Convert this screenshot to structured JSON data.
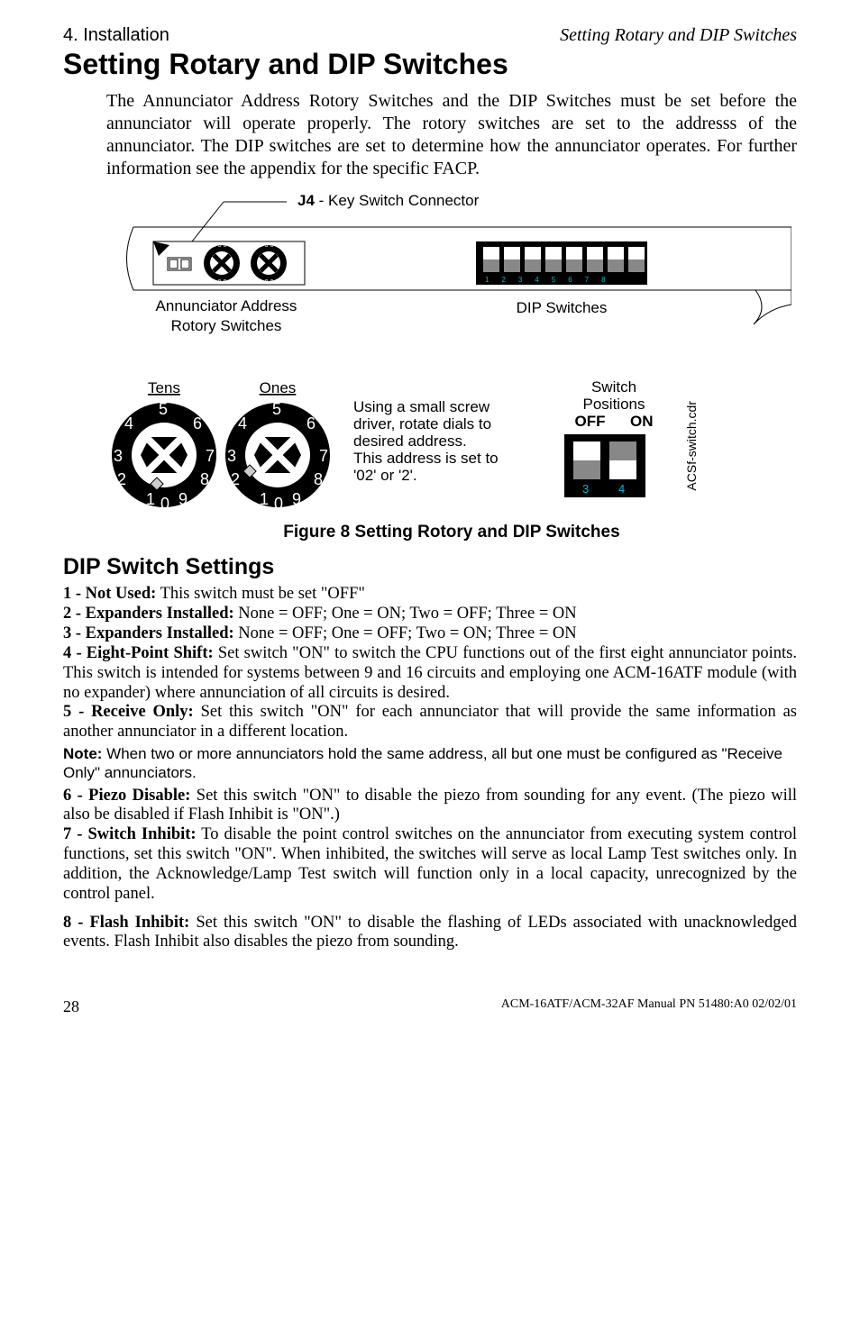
{
  "header": {
    "left": "4. Installation",
    "rightItalic": "Setting Rotary and DIP Switches"
  },
  "title": "Setting Rotary and DIP Switches",
  "intro": "The Annunciator Address Rotory Switches and the DIP Switches must be set before the annunciator will operate properly. The rotory switches are set to the addresss of the annunciator. The DIP switches are set to determine how the annunciator operates. For further information see the appendix for the specific FACP.",
  "figTop": {
    "j4Label": "J4",
    "j4Rest": " - Key Switch Connector",
    "annLine1": "Annunciator Address",
    "annLine2": "Rotory Switches",
    "dipLabel": "DIP Switches"
  },
  "figMid": {
    "tens": "Tens",
    "ones": "Ones",
    "instr1": "Using a small screw",
    "instr2": "driver, rotate dials to",
    "instr3": "desired address.",
    "instr4": "This address is set to",
    "instr5": "'02' or '2'.",
    "swLine1": "Switch",
    "swLine2": "Positions",
    "off": "OFF",
    "on": "ON",
    "cdr": "ACSf-switch.cdr"
  },
  "figCaption": "Figure 8  Setting Rotory and DIP Switches",
  "dipHeading": "DIP Switch Settings",
  "items": {
    "i1b": "1 - Not Used:",
    "i1": "  This switch must be set \"OFF\"",
    "i2b": "2 - Expanders Installed:",
    "i2": " None = OFF; One = ON; Two = OFF; Three = ON",
    "i3b": "3 - Expanders Installed:",
    "i3": " None = OFF; One = OFF; Two = ON; Three = ON",
    "i4b": "4 - Eight-Point Shift:",
    "i4": " Set switch \"ON\" to switch the CPU functions out of the first eight annunciator points. This switch is intended for systems between 9 and 16 circuits and employing one ACM-16ATF module (with no expander) where annunciation of all circuits is desired.",
    "i5b": "5 - Receive Only:",
    "i5": " Set this switch \"ON\" for each annunciator that will provide the same information as another annunciator in a different location.",
    "noteB": "Note:",
    "note": " When two or more annunciators hold the same address, all but one must be configured as \"Receive Only\" annunciators.",
    "i6b": "6 - Piezo Disable:",
    "i6": " Set this switch \"ON\" to disable the piezo from sounding for any event.  (The piezo will also be disabled if Flash Inhibit is \"ON\".)",
    "i7b": "7 - Switch Inhibit:",
    "i7": " To disable the point control switches on the annunciator from executing system control functions, set this switch \"ON\". When inhibited, the switches will serve as local Lamp Test switches only. In addition, the Acknowledge/Lamp Test switch will function only in a local capacity, unrecognized by the control panel.",
    "i8b": "8 - Flash Inhibit:",
    "i8": " Set this switch \"ON\" to disable the flashing of LEDs associated with unacknowledged events. Flash Inhibit also disables the piezo from sounding."
  },
  "footer": {
    "page": "28",
    "right": "ACM-16ATF/ACM-32AF Manual  PN 51480:A0  02/02/01"
  }
}
